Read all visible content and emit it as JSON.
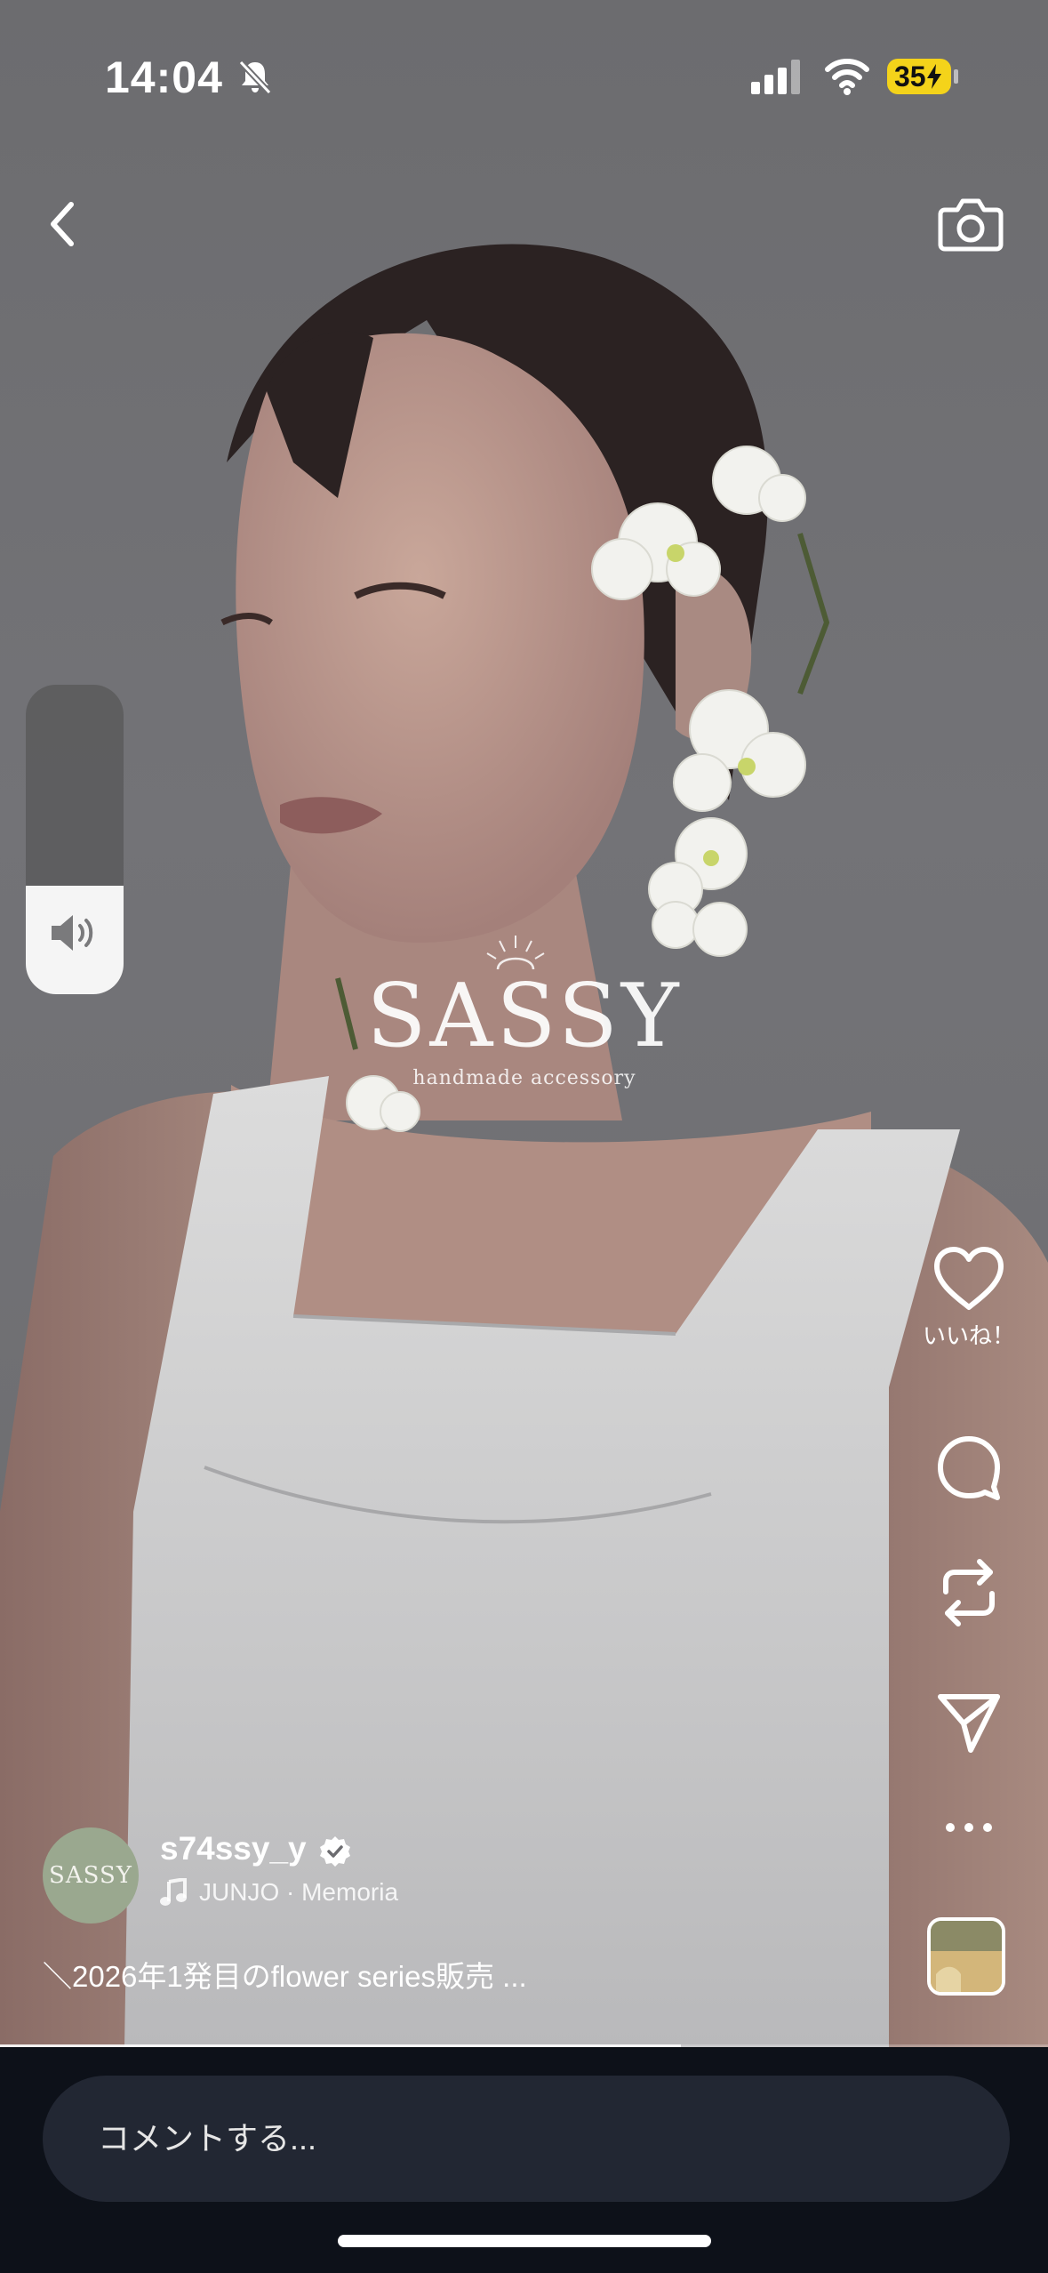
{
  "status_bar": {
    "time": "14:04",
    "battery": "35",
    "icons": [
      "bell-slash-icon",
      "cellular-signal-icon",
      "wifi-icon",
      "battery-charging-icon"
    ]
  },
  "nav": {
    "back_icon": "chevron-left-icon",
    "camera_icon": "camera-icon"
  },
  "volume": {
    "level": 0.35,
    "icon": "speaker-icon"
  },
  "watermark": {
    "brand": "SASSY",
    "tagline": "handmade accessory"
  },
  "actions": {
    "like_label": "いいね！",
    "icons": [
      "heart-icon",
      "comment-icon",
      "repost-icon",
      "send-icon",
      "more-icon"
    ]
  },
  "post": {
    "avatar_text": "SASSY",
    "username": "s74ssy_y",
    "verified": true,
    "music": "JUNJO · Memoria",
    "caption": "＼2026年1発目のflower series販売 ..."
  },
  "progress": 0.65,
  "comment": {
    "placeholder": "コメントする..."
  },
  "colors": {
    "battery": "#f4d31a",
    "bottom_bar": "#0d1119",
    "comment_field": "#222733"
  }
}
